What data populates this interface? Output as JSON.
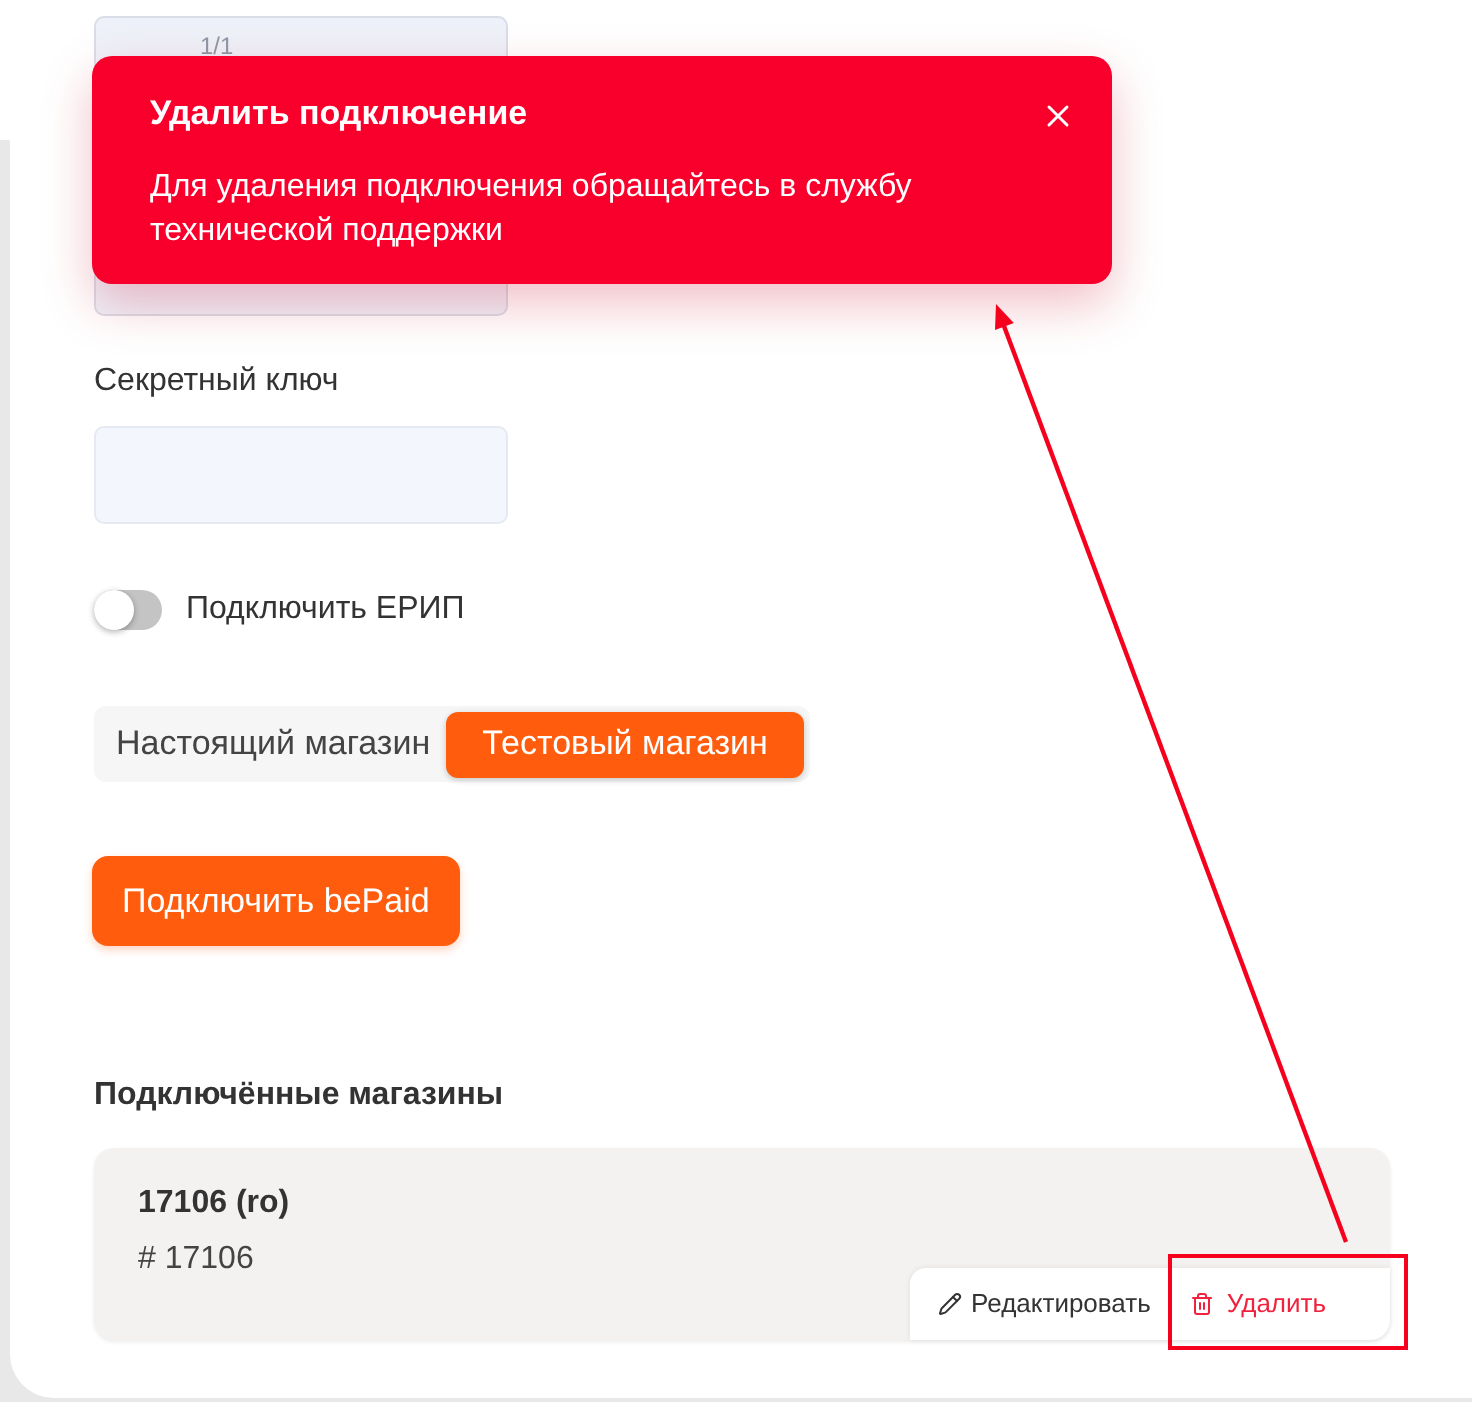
{
  "top_field": {
    "counter": "1/1"
  },
  "toast": {
    "title": "Удалить подключение",
    "message": "Для удаления подключения обращайтесь в службу технической поддержки"
  },
  "secret_key": {
    "label": "Секретный ключ"
  },
  "erip_toggle": {
    "label": "Подключить ЕРИП",
    "on": false
  },
  "shop_mode": [
    {
      "label": "Настоящий магазин",
      "selected": false
    },
    {
      "label": "Тестовый магазин",
      "selected": true
    }
  ],
  "connect_button": {
    "label": "Подключить bePaid"
  },
  "connected_shops": {
    "heading": "Подключённые магазины",
    "items": [
      {
        "name": "17106 (ro)",
        "number": "# 17106",
        "actions": [
          {
            "kind": "edit",
            "label": "Редактировать"
          },
          {
            "kind": "delete",
            "label": "Удалить"
          }
        ]
      }
    ]
  }
}
